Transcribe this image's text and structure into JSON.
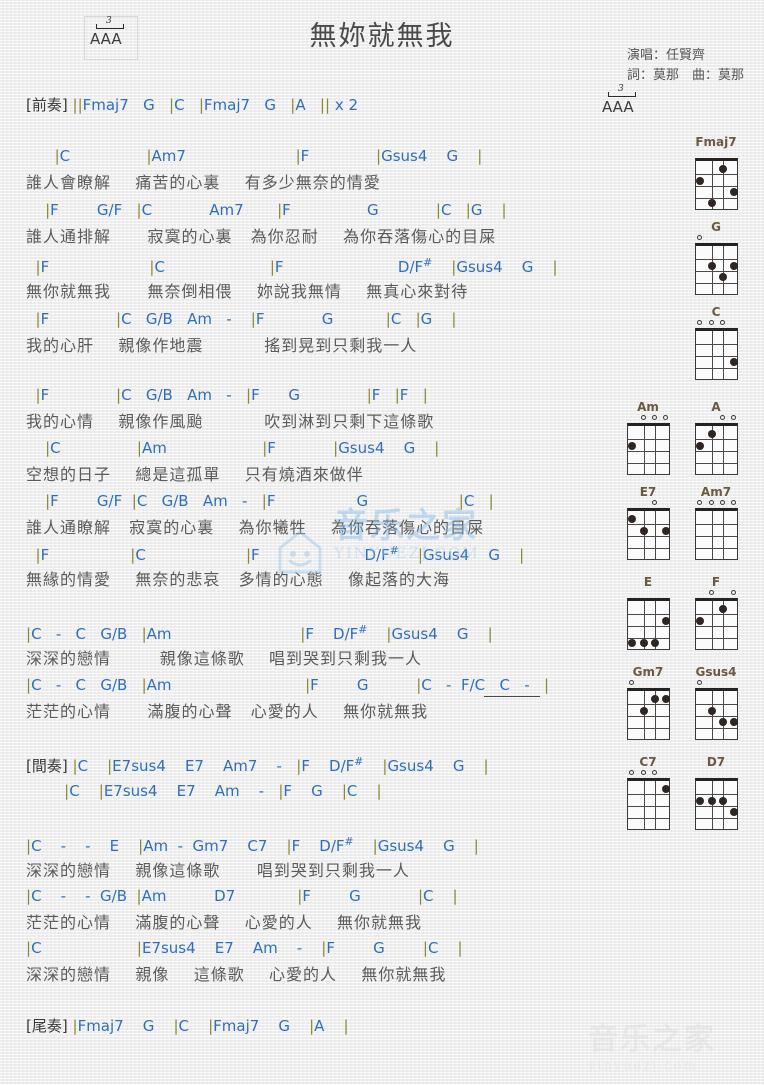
{
  "header": {
    "title": "無妳就無我",
    "singer_label": "演唱：任賢齊",
    "writer_label": "詞：莫那　曲：莫那",
    "strum_triplet_number": "3",
    "strum_arrows": "AAA"
  },
  "sections": {
    "intro_tag": "[前奏]",
    "interlude_tag": "[間奏]",
    "outro_tag": "[尾奏]"
  },
  "lines": [
    {
      "id": "intro_chords",
      "type": "chord",
      "text": "[前奏] ||Fmaj7   G   |C   |Fmaj7   G   |A   || x 2"
    },
    {
      "id": "c1",
      "type": "chord",
      "text": "      |C                |Am7                       |F              |Gsus4    G    |"
    },
    {
      "id": "l1",
      "type": "lyric",
      "text": "誰人會瞭解    痛苦的心裏    有多少無奈的情愛"
    },
    {
      "id": "c2",
      "type": "chord",
      "text": "    |F        G/F   |C            Am7       |F                G            |C   |G    |"
    },
    {
      "id": "l2",
      "type": "lyric",
      "text": "誰人通排解      寂寞的心裏   為你忍耐    為你吞落傷心的目屎"
    },
    {
      "id": "c3",
      "type": "chord",
      "text": "  |F                     |C                      |F                        D/F#    |Gsus4    G    |"
    },
    {
      "id": "l3",
      "type": "lyric",
      "text": "無你就無我      無奈倒相偎    妳說我無情    無真心來對待"
    },
    {
      "id": "c4",
      "type": "chord",
      "text": "  |F              |C   G/B   Am   -    |F            G           |C   |G    |"
    },
    {
      "id": "l4",
      "type": "lyric",
      "text": "我的心肝    親像作地震          搖到晃到只剩我一人"
    },
    {
      "id": "c5",
      "type": "chord",
      "text": "  |F              |C   G/B   Am   -   |F      G              |F   |F   |"
    },
    {
      "id": "l5",
      "type": "lyric",
      "text": "我的心情    親像作風颱          吹到淋到只剩下這條歌"
    },
    {
      "id": "c6",
      "type": "chord",
      "text": "    |C                |Am                    |F            |Gsus4    G    |"
    },
    {
      "id": "l6",
      "type": "lyric",
      "text": "空想的日子    總是這孤單    只有燒酒來做伴"
    },
    {
      "id": "c7",
      "type": "chord",
      "text": "    |F        G/F  |C   G/B   Am   -   |F                 G                   |C   |"
    },
    {
      "id": "l7",
      "type": "lyric",
      "text": "誰人通瞭解   寂寞的心裏    為你犧牲    為你吞落傷心的目屎"
    },
    {
      "id": "c8",
      "type": "chord",
      "text": "  |F                 |C                     |F                      D/F#    |Gsus4    G    |"
    },
    {
      "id": "l8",
      "type": "lyric",
      "text": "無緣的情愛    無奈的悲哀   多情的心態    像起落的大海"
    },
    {
      "id": "c9",
      "type": "chord",
      "text": "|C   -   C   G/B   |Am                           |F    D/F#    |Gsus4    G    |"
    },
    {
      "id": "l9",
      "type": "lyric",
      "text": "深深的戀情        親像這條歌    唱到哭到只剩我一人"
    },
    {
      "id": "c10",
      "type": "chord",
      "text": "|C   -   C   G/B   |Am                            |F        G          |C   -  F/C   C   -   |"
    },
    {
      "id": "l10",
      "type": "lyric",
      "text": "茫茫的心情      滿腹的心聲   心愛的人    無你就無我"
    },
    {
      "id": "c11",
      "type": "chord",
      "text": "[間奏] |C    |E7sus4    E7    Am7    -   |F    D/F#    |Gsus4    G    |"
    },
    {
      "id": "c12",
      "type": "chord",
      "text": "        |C    |E7sus4    E7    Am    -   |F    G    |C    |"
    },
    {
      "id": "c13",
      "type": "chord",
      "text": "|C    -    -    E    |Am  -  Gm7    C7    |F    D/F#    |Gsus4    G    |"
    },
    {
      "id": "l13",
      "type": "lyric",
      "text": "深深的戀情    親像這條歌      唱到哭到只剩我一人"
    },
    {
      "id": "c14",
      "type": "chord",
      "text": "|C    -    -  G/B  |Am          D7             |F        G            |C    |"
    },
    {
      "id": "l14",
      "type": "lyric",
      "text": "茫茫的心情    滿腹的心聲    心愛的人    無你就無我"
    },
    {
      "id": "c15",
      "type": "chord",
      "text": "|C                    |E7sus4    E7    Am    -    |F        G        |C    |"
    },
    {
      "id": "l15",
      "type": "lyric",
      "text": "深深的戀情    親像    這條歌    心愛的人    無你就無我"
    },
    {
      "id": "outro",
      "type": "chord",
      "text": "[尾奏] |Fmaj7    G    |C    |Fmaj7    G    |A    |"
    }
  ],
  "chord_diagrams": [
    {
      "name": "Fmaj7",
      "open": [],
      "dots": [
        {
          "s": 1,
          "f": 2
        },
        {
          "s": 2,
          "f": 4
        },
        {
          "s": 3,
          "f": 1
        },
        {
          "s": 4,
          "f": 3
        }
      ]
    },
    {
      "name": "G",
      "open": [
        1
      ],
      "dots": [
        {
          "s": 2,
          "f": 2
        },
        {
          "s": 3,
          "f": 3
        },
        {
          "s": 4,
          "f": 2
        }
      ]
    },
    {
      "name": "C",
      "open": [
        1,
        2,
        3
      ],
      "dots": [
        {
          "s": 4,
          "f": 3
        }
      ]
    },
    {
      "name": "Am",
      "open": [
        2,
        3,
        4
      ],
      "dots": [
        {
          "s": 1,
          "f": 2
        }
      ]
    },
    {
      "name": "A",
      "open": [
        3,
        4
      ],
      "dots": [
        {
          "s": 1,
          "f": 2
        },
        {
          "s": 2,
          "f": 1
        }
      ]
    },
    {
      "name": "E7",
      "open": [
        3
      ],
      "dots": [
        {
          "s": 1,
          "f": 1
        },
        {
          "s": 2,
          "f": 2
        },
        {
          "s": 4,
          "f": 2
        }
      ]
    },
    {
      "name": "Am7",
      "open": [
        1,
        2,
        3,
        4
      ],
      "dots": []
    },
    {
      "name": "E",
      "open": [],
      "dots": [
        {
          "s": 4,
          "f": 2
        },
        {
          "s": 1,
          "f": 4
        },
        {
          "s": 2,
          "f": 4
        },
        {
          "s": 3,
          "f": 4
        }
      ]
    },
    {
      "name": "F",
      "open": [
        2,
        4
      ],
      "dots": [
        {
          "s": 1,
          "f": 2
        },
        {
          "s": 3,
          "f": 1
        }
      ]
    },
    {
      "name": "Gm7",
      "open": [
        1
      ],
      "dots": [
        {
          "s": 2,
          "f": 2
        },
        {
          "s": 3,
          "f": 1
        },
        {
          "s": 4,
          "f": 1
        }
      ]
    },
    {
      "name": "Gsus4",
      "open": [
        1
      ],
      "dots": [
        {
          "s": 2,
          "f": 2
        },
        {
          "s": 3,
          "f": 3
        },
        {
          "s": 4,
          "f": 3
        }
      ]
    },
    {
      "name": "C7",
      "open": [
        1,
        2,
        3
      ],
      "dots": [
        {
          "s": 4,
          "f": 1
        }
      ]
    },
    {
      "name": "D7",
      "open": [],
      "dots": [
        {
          "s": 1,
          "f": 2
        },
        {
          "s": 2,
          "f": 2
        },
        {
          "s": 3,
          "f": 2
        },
        {
          "s": 4,
          "f": 3
        }
      ]
    }
  ],
  "watermark": {
    "cn_text": "音乐之家",
    "url_center": "YINYUEZJ.COM",
    "url_bottom": "yinyuezj.com"
  },
  "colors": {
    "chord_blue": "#2f6fba",
    "lyric_gray": "#5b5b5b",
    "barline": "#8a8a35",
    "diagram_name": "#6b5a42",
    "watermark_blue": "#79b5e6"
  }
}
